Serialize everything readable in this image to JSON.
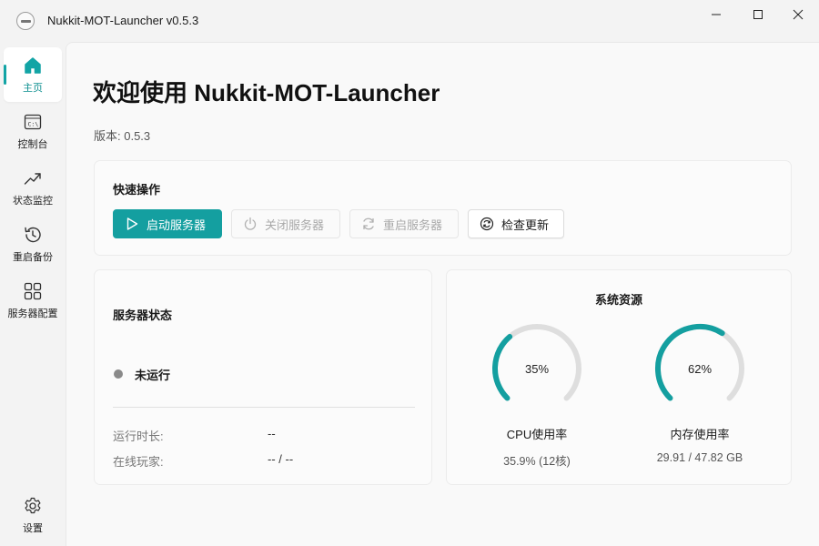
{
  "window": {
    "title": "Nukkit-MOT-Launcher v0.5.3"
  },
  "sidebar": {
    "items": [
      {
        "label": "主页",
        "icon": "home-icon",
        "active": true
      },
      {
        "label": "控制台",
        "icon": "console-icon"
      },
      {
        "label": "状态监控",
        "icon": "trend-icon"
      },
      {
        "label": "重启备份",
        "icon": "history-icon"
      },
      {
        "label": "服务器配置",
        "icon": "apps-icon"
      }
    ],
    "settings": {
      "label": "设置",
      "icon": "gear-icon"
    }
  },
  "main": {
    "title": "欢迎使用 Nukkit-MOT-Launcher",
    "version": "版本: 0.5.3"
  },
  "quick_actions": {
    "title": "快速操作",
    "buttons": [
      {
        "label": "启动服务器",
        "icon": "play-icon",
        "enabled": true
      },
      {
        "label": "关闭服务器",
        "icon": "power-icon",
        "enabled": false
      },
      {
        "label": "重启服务器",
        "icon": "refresh-icon",
        "enabled": false
      },
      {
        "label": "检查更新",
        "icon": "sync-icon",
        "enabled": true
      }
    ]
  },
  "server_status": {
    "title": "服务器状态",
    "state": "未运行",
    "uptime": {
      "label": "运行时长:",
      "value": "--"
    },
    "players": {
      "label": "在线玩家:",
      "value": "-- / --"
    }
  },
  "resources": {
    "title": "系统资源",
    "cpu": {
      "percent": 35,
      "display": "35%",
      "label": "CPU使用率",
      "detail": "35.9% (12核)"
    },
    "memory": {
      "percent": 62,
      "display": "62%",
      "label": "内存使用率",
      "detail": "29.91 / 47.82 GB"
    }
  },
  "colors": {
    "accent": "#149fa0",
    "track": "#dedede"
  }
}
